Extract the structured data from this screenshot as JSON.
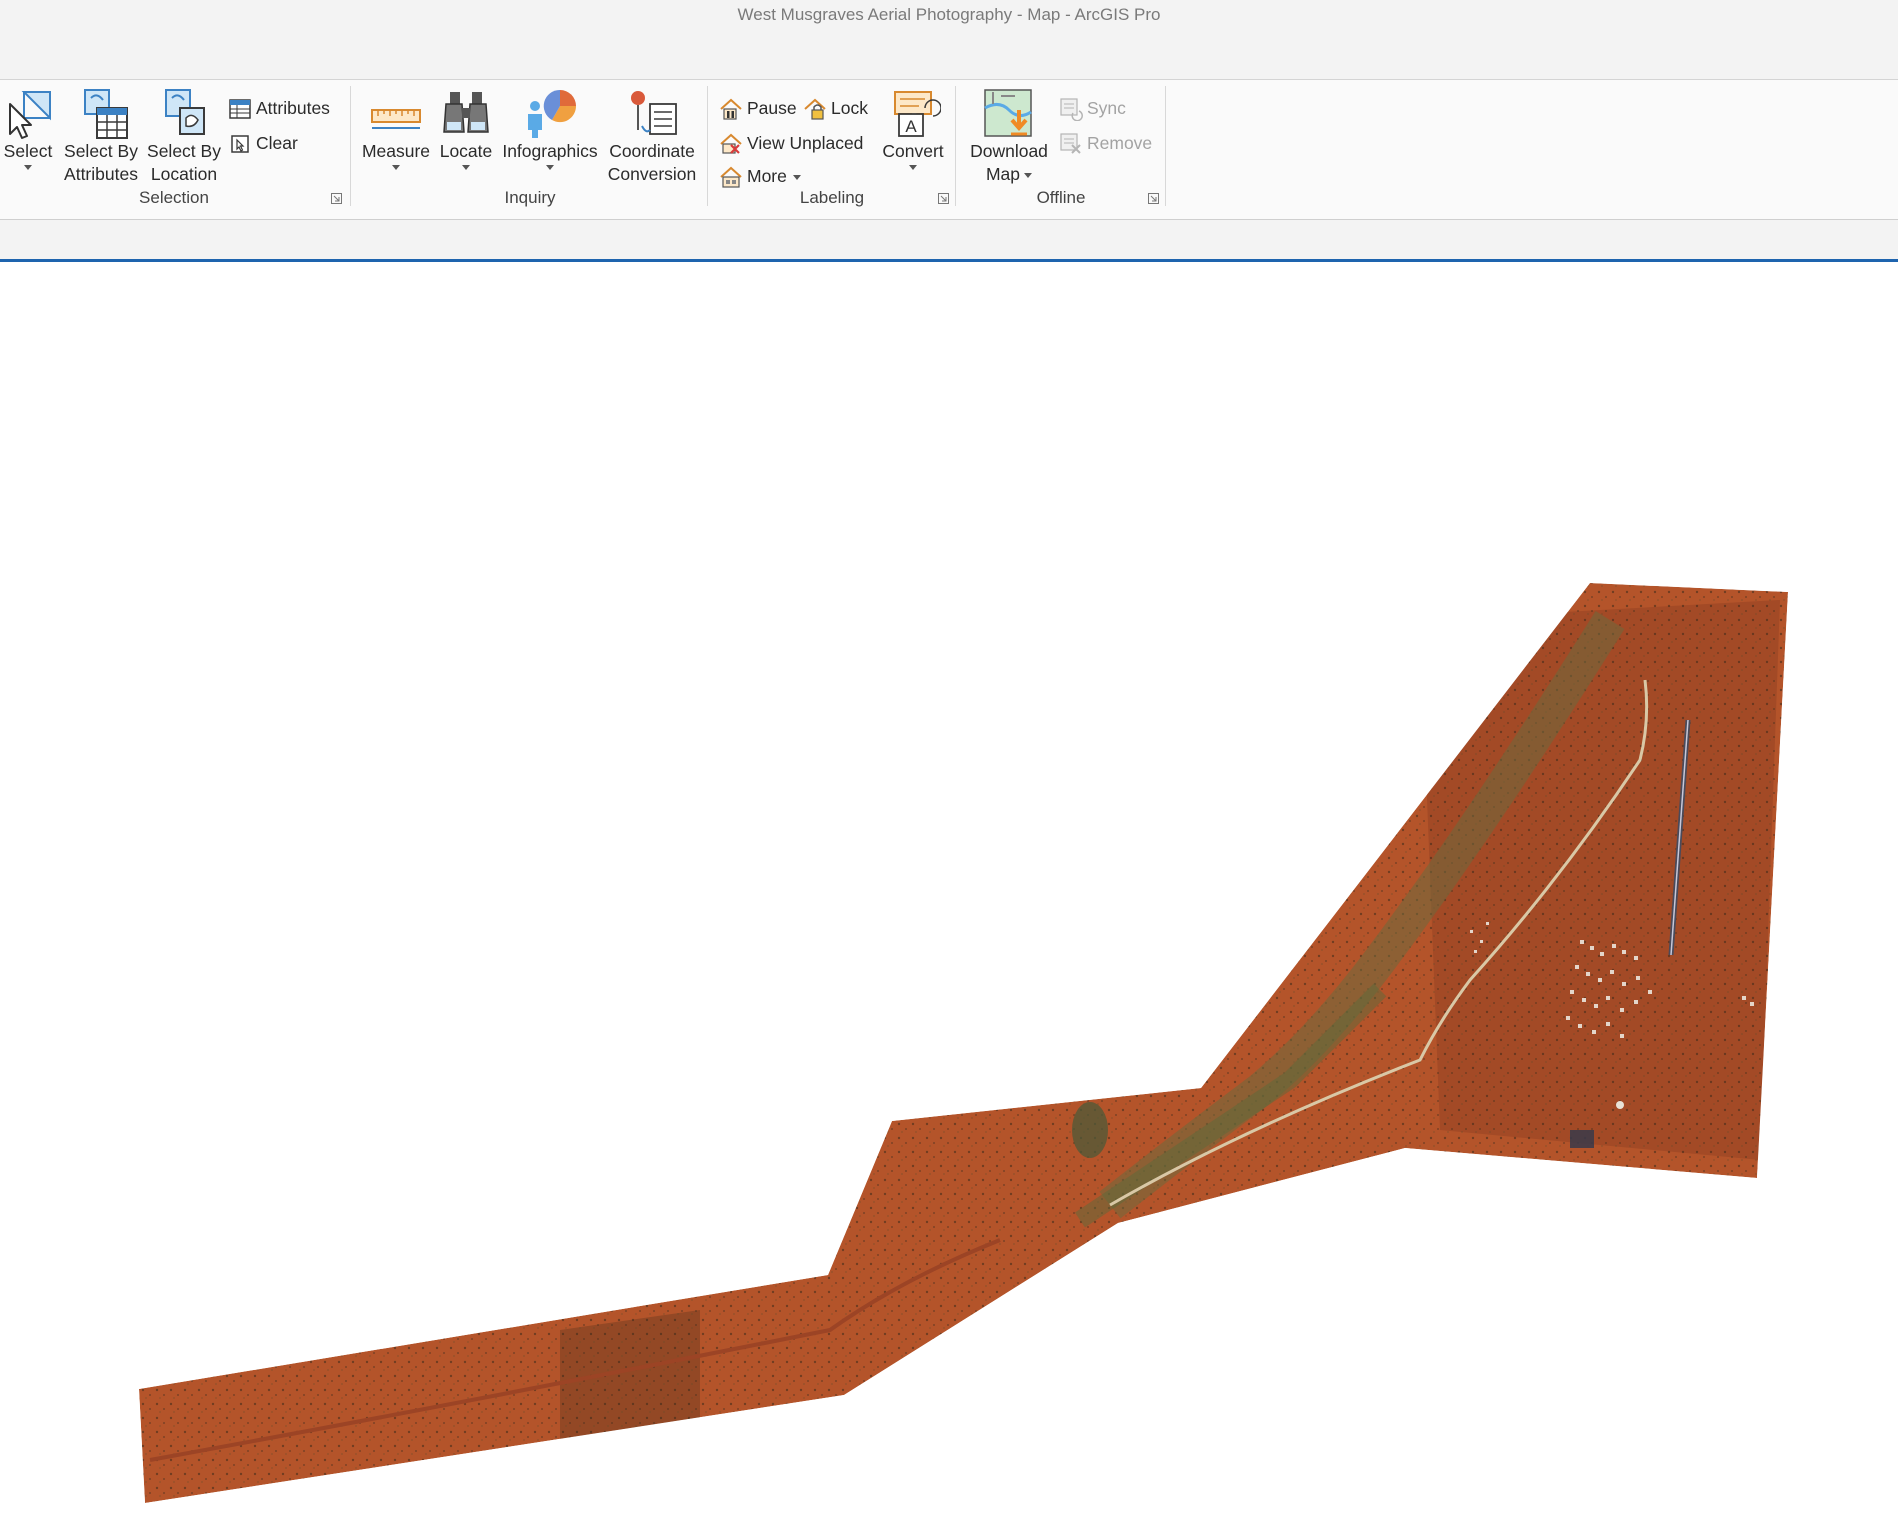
{
  "window": {
    "title": "West Musgraves Aerial Photography - Map - ArcGIS Pro"
  },
  "ribbon": {
    "groups": {
      "selection": {
        "label": "Selection",
        "select": {
          "label": "Select"
        },
        "select_by_attributes": {
          "line1": "Select By",
          "line2": "Attributes"
        },
        "select_by_location": {
          "line1": "Select By",
          "line2": "Location"
        },
        "attributes": {
          "label": "Attributes"
        },
        "clear": {
          "label": "Clear"
        }
      },
      "inquiry": {
        "label": "Inquiry",
        "measure": {
          "label": "Measure"
        },
        "locate": {
          "label": "Locate"
        },
        "infographics": {
          "label": "Infographics"
        },
        "coordinate_conversion": {
          "line1": "Coordinate",
          "line2": "Conversion"
        }
      },
      "labeling": {
        "label": "Labeling",
        "pause": {
          "label": "Pause"
        },
        "lock": {
          "label": "Lock"
        },
        "view_unplaced": {
          "label": "View Unplaced"
        },
        "more": {
          "label": "More"
        },
        "convert": {
          "label": "Convert"
        }
      },
      "offline": {
        "label": "Offline",
        "download_map": {
          "line1": "Download",
          "line2": "Map"
        },
        "sync": {
          "label": "Sync"
        },
        "remove": {
          "label": "Remove"
        }
      }
    }
  },
  "map": {
    "layer_colors": {
      "ground": "#b4542a",
      "ground_dark": "#8e3f22",
      "vegetation": "#6e6a3c",
      "track": "#d9c8a6"
    }
  }
}
